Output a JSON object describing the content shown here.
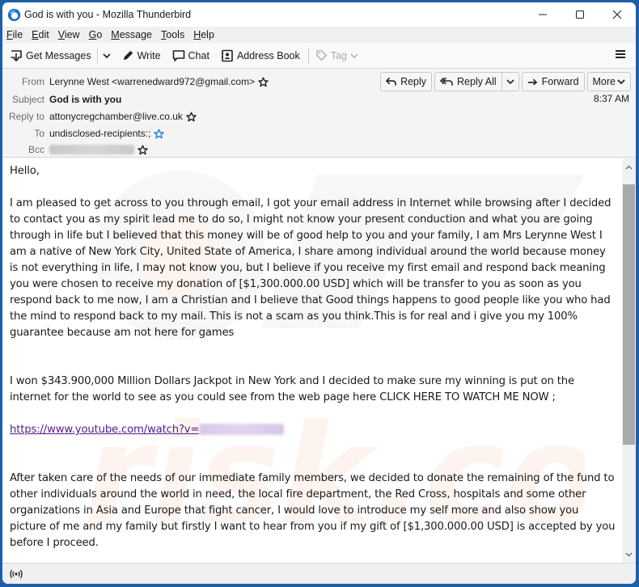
{
  "window": {
    "title": "God is with you - Mozilla Thunderbird",
    "controls": {
      "minimize": "minimize",
      "maximize": "maximize",
      "close": "close"
    }
  },
  "menubar": {
    "items": [
      {
        "label": "File",
        "accel": "F",
        "rest": "ile"
      },
      {
        "label": "Edit",
        "accel": "E",
        "rest": "dit"
      },
      {
        "label": "View",
        "accel": "V",
        "rest": "iew"
      },
      {
        "label": "Go",
        "accel": "G",
        "rest": "o"
      },
      {
        "label": "Message",
        "accel": "M",
        "rest": "essage"
      },
      {
        "label": "Tools",
        "accel": "T",
        "rest": "ools"
      },
      {
        "label": "Help",
        "accel": "H",
        "rest": "elp"
      }
    ]
  },
  "toolbar": {
    "get_messages": "Get Messages",
    "write": "Write",
    "chat": "Chat",
    "address_book": "Address Book",
    "tag": "Tag"
  },
  "header": {
    "from_label": "From",
    "from_value": "Lerynne West <warrenedward972@gmail.com>",
    "subject_label": "Subject",
    "subject_value": "God is with you",
    "reply_to_label": "Reply to",
    "reply_to_value": "attonycregchamber@live.co.uk",
    "to_label": "To",
    "to_value": "undisclosed-recipients:;",
    "bcc_label": "Bcc",
    "date": "8:37 AM",
    "actions": {
      "reply": "Reply",
      "reply_all": "Reply All",
      "forward": "Forward",
      "more": "More"
    }
  },
  "body": {
    "greeting": "Hello,",
    "para1": "I am pleased to get across to you through email, I got your email address in Internet while browsing after I decided to contact you as my spirit lead me to do so, I might not know your present conduction and what you are going through in life but I believed that this money will be of good help to you and your family, I am Mrs Lerynne West I am a native of New York City, United State of America, I share among individual around the world because money is not everything in life, I may not know you, but I believe if you receive my first email and respond back meaning you were chosen to receive my donation of [$1,300.000.00 USD] which will be transfer to you as soon as you respond back to me now, I am a Christian and I believe that Good things happens to good people like you who had the mind to respond back to my mail. This is not a scam as you think.This is for real and i give you my 100%",
    "para1_tail": "guarantee because am not here for games",
    "para2": "I won $343.900,000 Million Dollars Jackpot in New York and I decided to make sure my winning is put on the internet for the world to see as you could see from the web page here CLICK HERE TO WATCH ME NOW ;",
    "link": "https://www.youtube.com/watch?v=",
    "para3": "After taken care of the needs of our immediate family members, we decided to donate the remaining of the fund to other individuals around the world in need, the local fire department, the Red Cross, hospitals and some other organizations in Asia and Europe that fight cancer, I would love to introduce my self more and also show you picture of me and my family but firstly I want to hear from you if my gift of [$1,300.000.00 USD] is accepted by you before I proceed."
  },
  "scrollbar": {
    "position_fraction": 0.0,
    "visible_fraction": 0.64
  },
  "colors": {
    "accent": "#1f5fa8",
    "link": "#551a8b",
    "star_blue": "#1a7fd4"
  }
}
